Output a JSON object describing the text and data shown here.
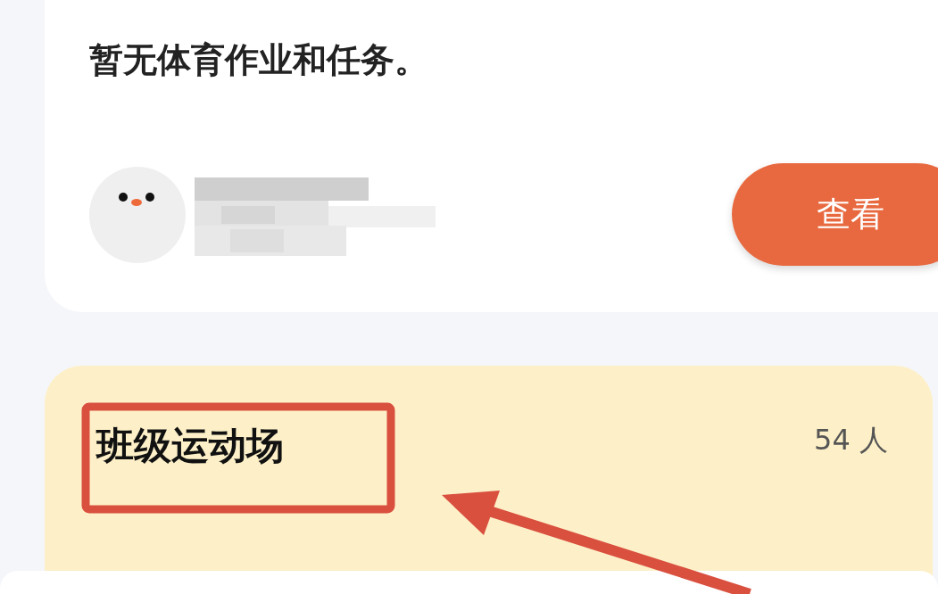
{
  "task_card": {
    "notice": "暂无体育作业和任务。",
    "view_button": "查看"
  },
  "class_card": {
    "title": "班级运动场",
    "count": "54 人"
  }
}
